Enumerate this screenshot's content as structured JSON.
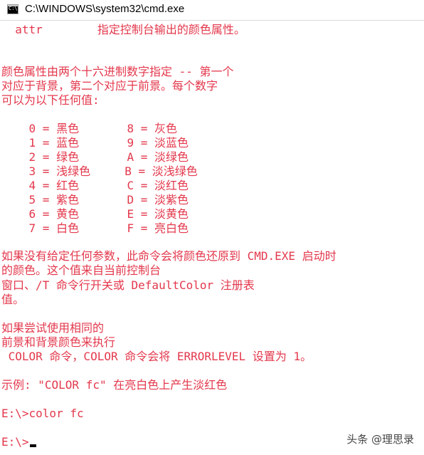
{
  "window": {
    "title": "C:\\WINDOWS\\system32\\cmd.exe",
    "icon_label": "C:\\."
  },
  "console": {
    "lines": [
      "  attr        指定控制台输出的颜色属性。",
      "",
      "颜色属性由两个十六进制数字指定 -- 第一个",
      "对应于背景，第二个对应于前景。每个数字",
      "可以为以下任何值:",
      "",
      "    0 = 黑色       8 = 灰色",
      "    1 = 蓝色       9 = 淡蓝色",
      "    2 = 绿色       A = 淡绿色",
      "    3 = 浅绿色     B = 淡浅绿色",
      "    4 = 红色       C = 淡红色",
      "    5 = 紫色       D = 淡紫色",
      "    6 = 黄色       E = 淡黄色",
      "    7 = 白色       F = 亮白色",
      "",
      "如果没有给定任何参数，此命令会将颜色还原到 CMD.EXE 启动时",
      "的颜色。这个值来自当前控制台",
      "窗口、/T 命令行开关或 DefaultColor 注册表",
      "值。",
      "",
      "如果尝试使用相同的",
      "前景和背景颜色来执行",
      " COLOR 命令，COLOR 命令会将 ERRORLEVEL 设置为 1。",
      "",
      "示例: \"COLOR fc\" 在亮白色上产生淡红色",
      "",
      "E:\\>color fc",
      "",
      "E:\\>"
    ],
    "text_color": "#e3384c",
    "background_color": "#ffffff"
  },
  "watermark": {
    "text": "头条 @理思录"
  }
}
